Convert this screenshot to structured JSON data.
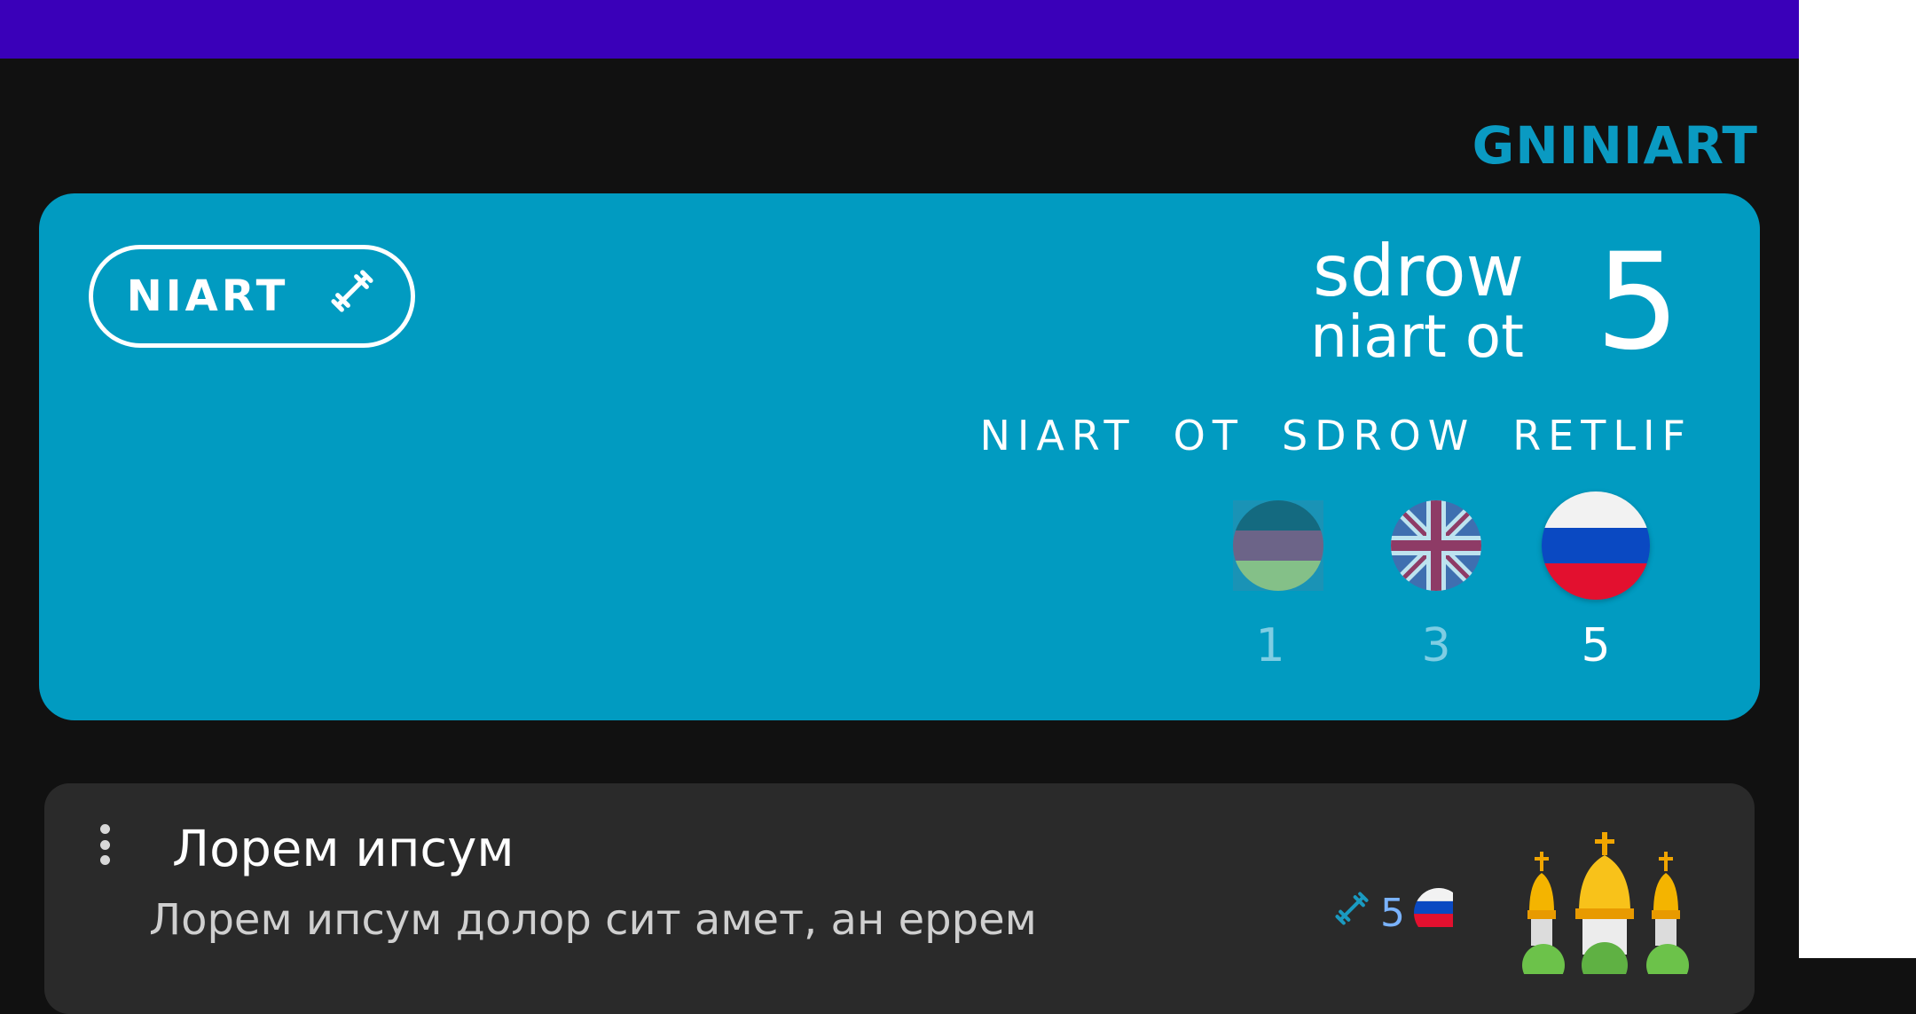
{
  "section": {
    "title": "GNINIART"
  },
  "train_card": {
    "train_button_label": "NIART",
    "words_line1": "sdrow",
    "words_line2": "niart ot",
    "words_count": "5",
    "filter": [
      "NIART",
      "OT",
      "SDROW",
      "RETLIF"
    ],
    "languages": [
      {
        "icon": "mixed-flag-icon",
        "count": "1",
        "selected": false
      },
      {
        "icon": "uk-flag-icon",
        "count": "3",
        "selected": false
      },
      {
        "icon": "russia-flag-icon",
        "count": "5",
        "selected": true
      }
    ]
  },
  "word_card": {
    "title": "Лорем ипсум",
    "description": "Лорем ипсум долор сит амет, ан еррем",
    "train_count": "5",
    "language_icon": "russia-flag-icon",
    "image_icon": "church-icon"
  },
  "colors": {
    "topbar": "#3a00b9",
    "accent": "#019bc1",
    "title": "#0a9ac2",
    "background": "#111111",
    "card": "#2a2a2a"
  }
}
